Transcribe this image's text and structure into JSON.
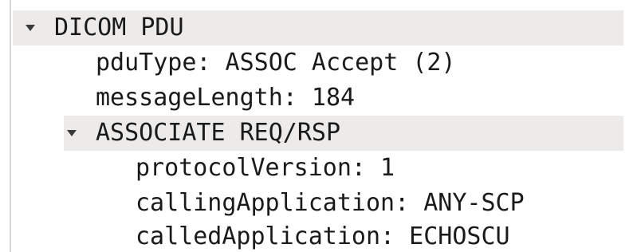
{
  "tree": {
    "root": {
      "label": "DICOM PDU",
      "icon": "caret-down-icon",
      "fields": {
        "pdu_type": "pduType: ASSOC Accept (2)",
        "message_length": "messageLength: 184"
      },
      "child": {
        "label": "ASSOCIATE REQ/RSP",
        "icon": "caret-down-icon",
        "fields": {
          "protocol_version": "protocolVersion: 1",
          "calling_application": "callingApplication: ANY-SCP",
          "called_application": "calledApplication: ECHOSCU"
        }
      }
    }
  },
  "colors": {
    "header_background": "#ecebea",
    "text": "#1a1a1a",
    "caret": "#3a3a3a"
  }
}
